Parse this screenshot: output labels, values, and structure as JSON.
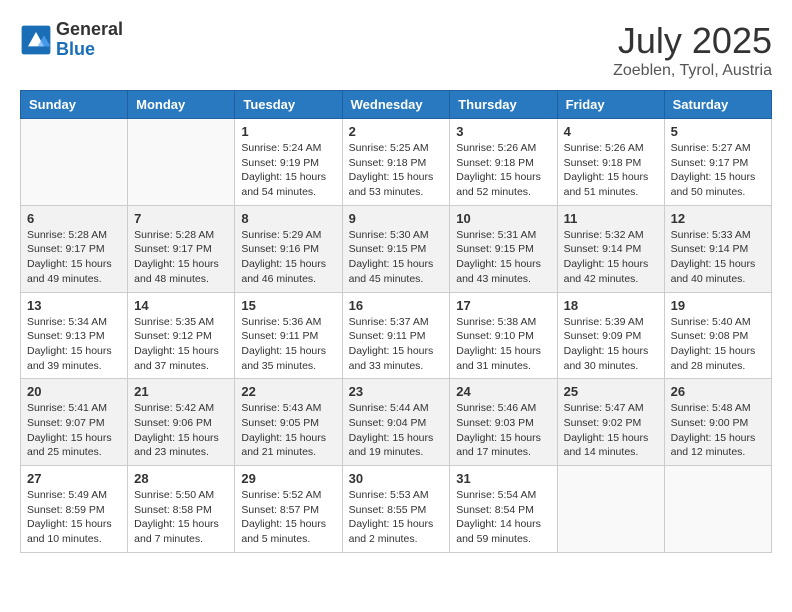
{
  "header": {
    "logo_general": "General",
    "logo_blue": "Blue",
    "month_year": "July 2025",
    "location": "Zoeblen, Tyrol, Austria"
  },
  "weekdays": [
    "Sunday",
    "Monday",
    "Tuesday",
    "Wednesday",
    "Thursday",
    "Friday",
    "Saturday"
  ],
  "weeks": [
    [
      {
        "day": "",
        "info": ""
      },
      {
        "day": "",
        "info": ""
      },
      {
        "day": "1",
        "info": "Sunrise: 5:24 AM\nSunset: 9:19 PM\nDaylight: 15 hours and 54 minutes."
      },
      {
        "day": "2",
        "info": "Sunrise: 5:25 AM\nSunset: 9:18 PM\nDaylight: 15 hours and 53 minutes."
      },
      {
        "day": "3",
        "info": "Sunrise: 5:26 AM\nSunset: 9:18 PM\nDaylight: 15 hours and 52 minutes."
      },
      {
        "day": "4",
        "info": "Sunrise: 5:26 AM\nSunset: 9:18 PM\nDaylight: 15 hours and 51 minutes."
      },
      {
        "day": "5",
        "info": "Sunrise: 5:27 AM\nSunset: 9:17 PM\nDaylight: 15 hours and 50 minutes."
      }
    ],
    [
      {
        "day": "6",
        "info": "Sunrise: 5:28 AM\nSunset: 9:17 PM\nDaylight: 15 hours and 49 minutes."
      },
      {
        "day": "7",
        "info": "Sunrise: 5:28 AM\nSunset: 9:17 PM\nDaylight: 15 hours and 48 minutes."
      },
      {
        "day": "8",
        "info": "Sunrise: 5:29 AM\nSunset: 9:16 PM\nDaylight: 15 hours and 46 minutes."
      },
      {
        "day": "9",
        "info": "Sunrise: 5:30 AM\nSunset: 9:15 PM\nDaylight: 15 hours and 45 minutes."
      },
      {
        "day": "10",
        "info": "Sunrise: 5:31 AM\nSunset: 9:15 PM\nDaylight: 15 hours and 43 minutes."
      },
      {
        "day": "11",
        "info": "Sunrise: 5:32 AM\nSunset: 9:14 PM\nDaylight: 15 hours and 42 minutes."
      },
      {
        "day": "12",
        "info": "Sunrise: 5:33 AM\nSunset: 9:14 PM\nDaylight: 15 hours and 40 minutes."
      }
    ],
    [
      {
        "day": "13",
        "info": "Sunrise: 5:34 AM\nSunset: 9:13 PM\nDaylight: 15 hours and 39 minutes."
      },
      {
        "day": "14",
        "info": "Sunrise: 5:35 AM\nSunset: 9:12 PM\nDaylight: 15 hours and 37 minutes."
      },
      {
        "day": "15",
        "info": "Sunrise: 5:36 AM\nSunset: 9:11 PM\nDaylight: 15 hours and 35 minutes."
      },
      {
        "day": "16",
        "info": "Sunrise: 5:37 AM\nSunset: 9:11 PM\nDaylight: 15 hours and 33 minutes."
      },
      {
        "day": "17",
        "info": "Sunrise: 5:38 AM\nSunset: 9:10 PM\nDaylight: 15 hours and 31 minutes."
      },
      {
        "day": "18",
        "info": "Sunrise: 5:39 AM\nSunset: 9:09 PM\nDaylight: 15 hours and 30 minutes."
      },
      {
        "day": "19",
        "info": "Sunrise: 5:40 AM\nSunset: 9:08 PM\nDaylight: 15 hours and 28 minutes."
      }
    ],
    [
      {
        "day": "20",
        "info": "Sunrise: 5:41 AM\nSunset: 9:07 PM\nDaylight: 15 hours and 25 minutes."
      },
      {
        "day": "21",
        "info": "Sunrise: 5:42 AM\nSunset: 9:06 PM\nDaylight: 15 hours and 23 minutes."
      },
      {
        "day": "22",
        "info": "Sunrise: 5:43 AM\nSunset: 9:05 PM\nDaylight: 15 hours and 21 minutes."
      },
      {
        "day": "23",
        "info": "Sunrise: 5:44 AM\nSunset: 9:04 PM\nDaylight: 15 hours and 19 minutes."
      },
      {
        "day": "24",
        "info": "Sunrise: 5:46 AM\nSunset: 9:03 PM\nDaylight: 15 hours and 17 minutes."
      },
      {
        "day": "25",
        "info": "Sunrise: 5:47 AM\nSunset: 9:02 PM\nDaylight: 15 hours and 14 minutes."
      },
      {
        "day": "26",
        "info": "Sunrise: 5:48 AM\nSunset: 9:00 PM\nDaylight: 15 hours and 12 minutes."
      }
    ],
    [
      {
        "day": "27",
        "info": "Sunrise: 5:49 AM\nSunset: 8:59 PM\nDaylight: 15 hours and 10 minutes."
      },
      {
        "day": "28",
        "info": "Sunrise: 5:50 AM\nSunset: 8:58 PM\nDaylight: 15 hours and 7 minutes."
      },
      {
        "day": "29",
        "info": "Sunrise: 5:52 AM\nSunset: 8:57 PM\nDaylight: 15 hours and 5 minutes."
      },
      {
        "day": "30",
        "info": "Sunrise: 5:53 AM\nSunset: 8:55 PM\nDaylight: 15 hours and 2 minutes."
      },
      {
        "day": "31",
        "info": "Sunrise: 5:54 AM\nSunset: 8:54 PM\nDaylight: 14 hours and 59 minutes."
      },
      {
        "day": "",
        "info": ""
      },
      {
        "day": "",
        "info": ""
      }
    ]
  ]
}
